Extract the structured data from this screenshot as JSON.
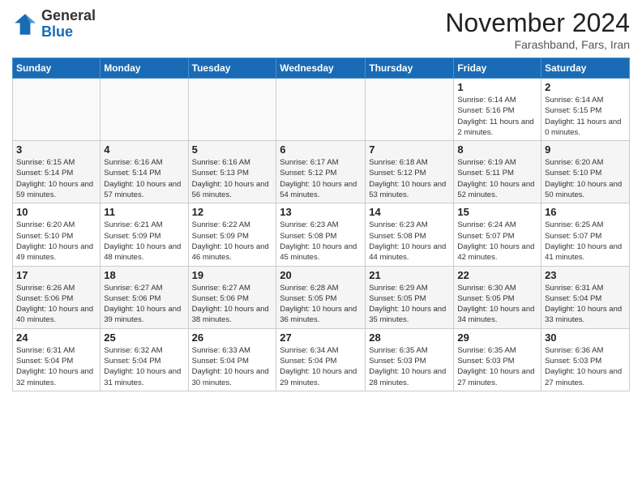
{
  "logo": {
    "general": "General",
    "blue": "Blue"
  },
  "header": {
    "month": "November 2024",
    "location": "Farashband, Fars, Iran"
  },
  "weekdays": [
    "Sunday",
    "Monday",
    "Tuesday",
    "Wednesday",
    "Thursday",
    "Friday",
    "Saturday"
  ],
  "weeks": [
    [
      {
        "day": "",
        "info": ""
      },
      {
        "day": "",
        "info": ""
      },
      {
        "day": "",
        "info": ""
      },
      {
        "day": "",
        "info": ""
      },
      {
        "day": "",
        "info": ""
      },
      {
        "day": "1",
        "info": "Sunrise: 6:14 AM\nSunset: 5:16 PM\nDaylight: 11 hours and 2 minutes."
      },
      {
        "day": "2",
        "info": "Sunrise: 6:14 AM\nSunset: 5:15 PM\nDaylight: 11 hours and 0 minutes."
      }
    ],
    [
      {
        "day": "3",
        "info": "Sunrise: 6:15 AM\nSunset: 5:14 PM\nDaylight: 10 hours and 59 minutes."
      },
      {
        "day": "4",
        "info": "Sunrise: 6:16 AM\nSunset: 5:14 PM\nDaylight: 10 hours and 57 minutes."
      },
      {
        "day": "5",
        "info": "Sunrise: 6:16 AM\nSunset: 5:13 PM\nDaylight: 10 hours and 56 minutes."
      },
      {
        "day": "6",
        "info": "Sunrise: 6:17 AM\nSunset: 5:12 PM\nDaylight: 10 hours and 54 minutes."
      },
      {
        "day": "7",
        "info": "Sunrise: 6:18 AM\nSunset: 5:12 PM\nDaylight: 10 hours and 53 minutes."
      },
      {
        "day": "8",
        "info": "Sunrise: 6:19 AM\nSunset: 5:11 PM\nDaylight: 10 hours and 52 minutes."
      },
      {
        "day": "9",
        "info": "Sunrise: 6:20 AM\nSunset: 5:10 PM\nDaylight: 10 hours and 50 minutes."
      }
    ],
    [
      {
        "day": "10",
        "info": "Sunrise: 6:20 AM\nSunset: 5:10 PM\nDaylight: 10 hours and 49 minutes."
      },
      {
        "day": "11",
        "info": "Sunrise: 6:21 AM\nSunset: 5:09 PM\nDaylight: 10 hours and 48 minutes."
      },
      {
        "day": "12",
        "info": "Sunrise: 6:22 AM\nSunset: 5:09 PM\nDaylight: 10 hours and 46 minutes."
      },
      {
        "day": "13",
        "info": "Sunrise: 6:23 AM\nSunset: 5:08 PM\nDaylight: 10 hours and 45 minutes."
      },
      {
        "day": "14",
        "info": "Sunrise: 6:23 AM\nSunset: 5:08 PM\nDaylight: 10 hours and 44 minutes."
      },
      {
        "day": "15",
        "info": "Sunrise: 6:24 AM\nSunset: 5:07 PM\nDaylight: 10 hours and 42 minutes."
      },
      {
        "day": "16",
        "info": "Sunrise: 6:25 AM\nSunset: 5:07 PM\nDaylight: 10 hours and 41 minutes."
      }
    ],
    [
      {
        "day": "17",
        "info": "Sunrise: 6:26 AM\nSunset: 5:06 PM\nDaylight: 10 hours and 40 minutes."
      },
      {
        "day": "18",
        "info": "Sunrise: 6:27 AM\nSunset: 5:06 PM\nDaylight: 10 hours and 39 minutes."
      },
      {
        "day": "19",
        "info": "Sunrise: 6:27 AM\nSunset: 5:06 PM\nDaylight: 10 hours and 38 minutes."
      },
      {
        "day": "20",
        "info": "Sunrise: 6:28 AM\nSunset: 5:05 PM\nDaylight: 10 hours and 36 minutes."
      },
      {
        "day": "21",
        "info": "Sunrise: 6:29 AM\nSunset: 5:05 PM\nDaylight: 10 hours and 35 minutes."
      },
      {
        "day": "22",
        "info": "Sunrise: 6:30 AM\nSunset: 5:05 PM\nDaylight: 10 hours and 34 minutes."
      },
      {
        "day": "23",
        "info": "Sunrise: 6:31 AM\nSunset: 5:04 PM\nDaylight: 10 hours and 33 minutes."
      }
    ],
    [
      {
        "day": "24",
        "info": "Sunrise: 6:31 AM\nSunset: 5:04 PM\nDaylight: 10 hours and 32 minutes."
      },
      {
        "day": "25",
        "info": "Sunrise: 6:32 AM\nSunset: 5:04 PM\nDaylight: 10 hours and 31 minutes."
      },
      {
        "day": "26",
        "info": "Sunrise: 6:33 AM\nSunset: 5:04 PM\nDaylight: 10 hours and 30 minutes."
      },
      {
        "day": "27",
        "info": "Sunrise: 6:34 AM\nSunset: 5:04 PM\nDaylight: 10 hours and 29 minutes."
      },
      {
        "day": "28",
        "info": "Sunrise: 6:35 AM\nSunset: 5:03 PM\nDaylight: 10 hours and 28 minutes."
      },
      {
        "day": "29",
        "info": "Sunrise: 6:35 AM\nSunset: 5:03 PM\nDaylight: 10 hours and 27 minutes."
      },
      {
        "day": "30",
        "info": "Sunrise: 6:36 AM\nSunset: 5:03 PM\nDaylight: 10 hours and 27 minutes."
      }
    ]
  ]
}
